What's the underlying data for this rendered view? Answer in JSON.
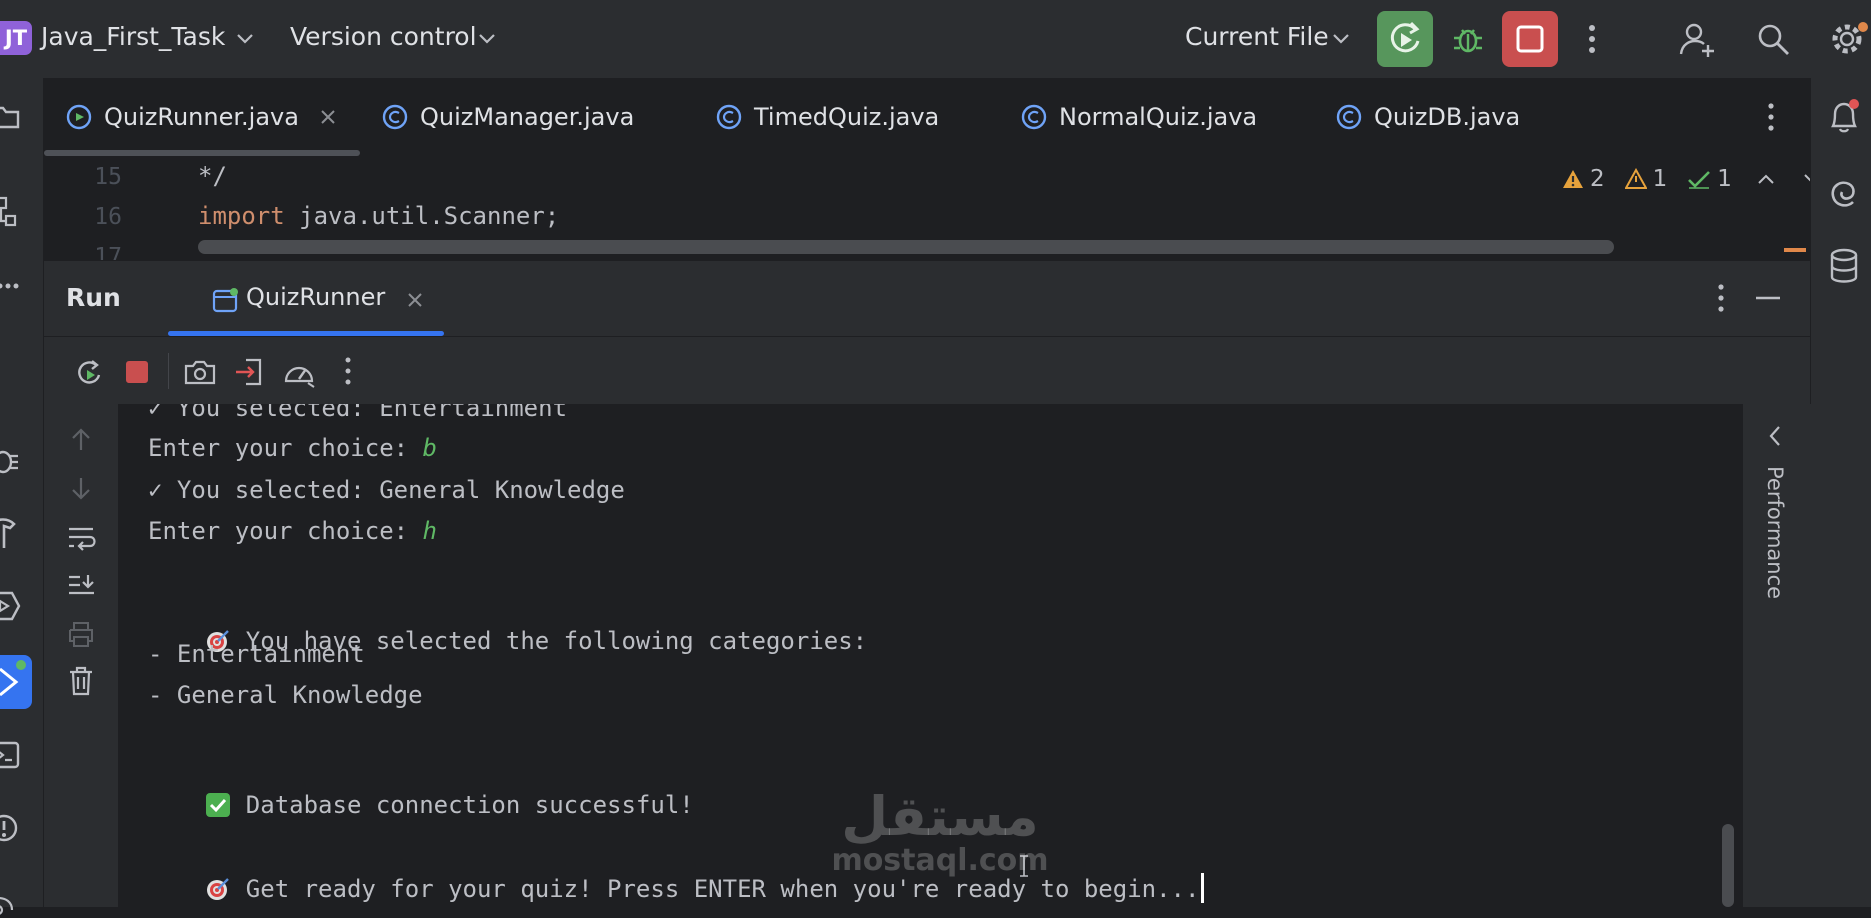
{
  "titlebar": {
    "project_badge": "JT",
    "project_name": "Java_First_Task",
    "vcs_label": "Version control",
    "run_config": "Current File"
  },
  "editor": {
    "tabs": [
      {
        "label": "QuizRunner.java",
        "active": true
      },
      {
        "label": "QuizManager.java"
      },
      {
        "label": "TimedQuiz.java"
      },
      {
        "label": "NormalQuiz.java"
      },
      {
        "label": "QuizDB.java"
      }
    ],
    "lines": [
      {
        "num": "15",
        "text": "*/"
      },
      {
        "num": "16",
        "keyword": "import",
        "text": " java.util.Scanner;"
      },
      {
        "num": "17",
        "text": ""
      }
    ],
    "inspections": {
      "warnings": "2",
      "weak_warnings": "1",
      "ok": "1"
    }
  },
  "run_window": {
    "title": "Run",
    "tab_label": "QuizRunner",
    "side_panel_label": "Performance"
  },
  "console": {
    "line1": "✓ You selected: Entertainment",
    "line2_prompt": "Enter your choice: ",
    "line2_input": "b",
    "line3": "✓ You selected: General Knowledge",
    "line4_prompt": "Enter your choice: ",
    "line4_input": "h",
    "line5": "You have selected the following categories:",
    "line6": "- Entertainment",
    "line7": "- General Knowledge",
    "line8": "Database connection successful!",
    "line9": "Get ready for your quiz! Press ENTER when you're ready to begin..."
  },
  "watermark": {
    "arabic": "مستقل",
    "latin": "mostaql.com"
  },
  "colors": {
    "bg": "#1e1f22",
    "panel": "#2b2d30",
    "run_green": "#57965c",
    "stop_red": "#c94f4f",
    "accent_blue": "#3574f0",
    "keyword_orange": "#cf8e6d",
    "input_green": "#5fb865"
  }
}
